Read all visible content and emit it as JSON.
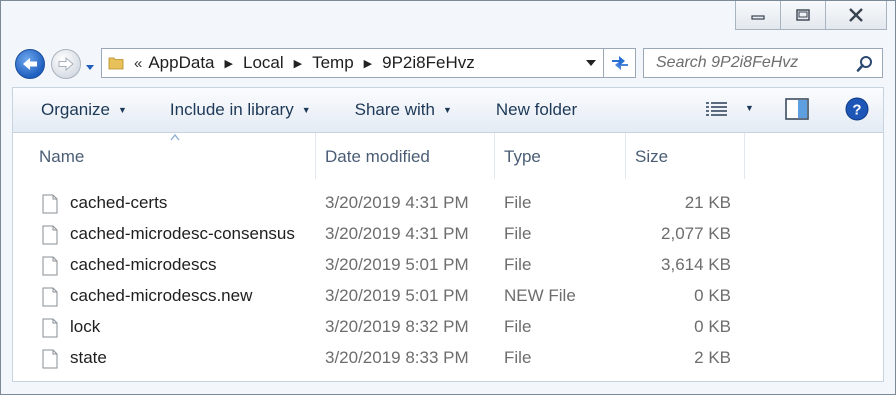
{
  "window": {
    "caption": {
      "minimize": "minimize-icon",
      "restore": "restore-icon",
      "close": "close-icon"
    }
  },
  "address": {
    "overflow": "«",
    "crumbs": [
      "AppData",
      "Local",
      "Temp",
      "9P2i8FeHvz"
    ]
  },
  "search": {
    "placeholder": "Search 9P2i8FeHvz"
  },
  "toolbar": {
    "organize": "Organize",
    "include": "Include in library",
    "share": "Share with",
    "new_folder": "New folder"
  },
  "columns": {
    "name": "Name",
    "date": "Date modified",
    "type": "Type",
    "size": "Size"
  },
  "files": [
    {
      "name": "cached-certs",
      "date": "3/20/2019 4:31 PM",
      "type": "File",
      "size": "21 KB"
    },
    {
      "name": "cached-microdesc-consensus",
      "date": "3/20/2019 4:31 PM",
      "type": "File",
      "size": "2,077 KB"
    },
    {
      "name": "cached-microdescs",
      "date": "3/20/2019 5:01 PM",
      "type": "File",
      "size": "3,614 KB"
    },
    {
      "name": "cached-microdescs.new",
      "date": "3/20/2019 5:01 PM",
      "type": "NEW File",
      "size": "0 KB"
    },
    {
      "name": "lock",
      "date": "3/20/2019 8:32 PM",
      "type": "File",
      "size": "0 KB"
    },
    {
      "name": "state",
      "date": "3/20/2019 8:33 PM",
      "type": "File",
      "size": "2 KB"
    }
  ]
}
